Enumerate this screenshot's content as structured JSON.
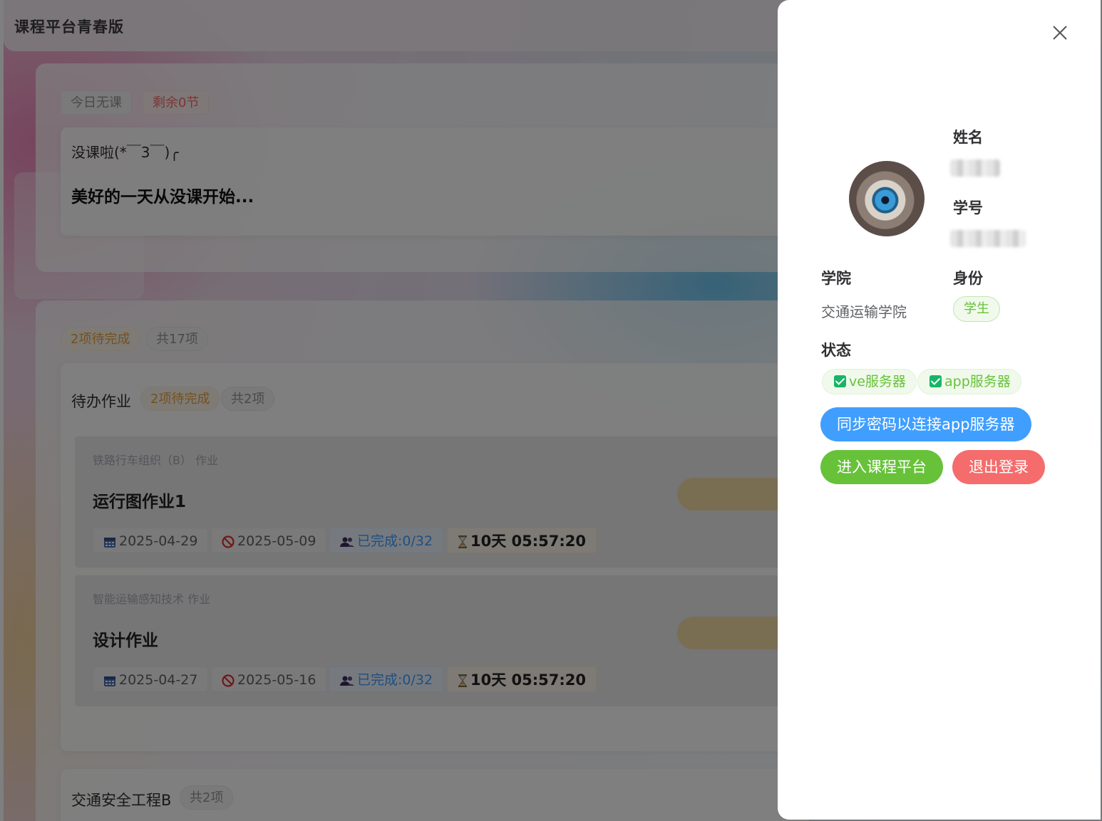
{
  "app": {
    "title": "课程平台青春版"
  },
  "today_card": {
    "tag_no_class": "今日无课",
    "tag_remaining": "剩余0节",
    "no_class_text": "没课啦(*￣3￣)╭",
    "motto": "美好的一天从没课开始..."
  },
  "homework_section": {
    "tag_pending": "2项待完成",
    "tag_total": "共17项",
    "group_title": "待办作业",
    "group_pending": "2项待完成",
    "group_total": "共2项",
    "items": [
      {
        "course": "铁路行车组织（B） 作业",
        "title": "运行图作业1",
        "start_date": "2025-04-29",
        "due_date": "2025-05-09",
        "completed": "已完成:0/32",
        "countdown": "10天 05:57:20"
      },
      {
        "course": "智能运输感知技术 作业",
        "title": "设计作业",
        "start_date": "2025-04-27",
        "due_date": "2025-05-16",
        "completed": "已完成:0/32",
        "countdown": "10天 05:57:20"
      }
    ],
    "next_group_title": "交通安全工程B",
    "next_group_total": "共2项"
  },
  "drawer": {
    "name_label": "姓名",
    "id_label": "学号",
    "college_label": "学院",
    "college_value": "交通运输学院",
    "role_label": "身份",
    "role_value": "学生",
    "status_label": "状态",
    "server_ve": "ve服务器",
    "server_app": "app服务器",
    "sync_button": "同步密码以连接app服务器",
    "enter_button": "进入课程平台",
    "logout_button": "退出登录"
  },
  "colors": {
    "primary": "#409eff",
    "success": "#67c23a",
    "danger": "#f56c6c",
    "warning": "#e6a23c",
    "info": "#909399"
  },
  "icons": [
    "calendar-icon",
    "forbidden-icon",
    "users-icon",
    "hourglass-icon",
    "close-icon",
    "checkbox-icon"
  ]
}
